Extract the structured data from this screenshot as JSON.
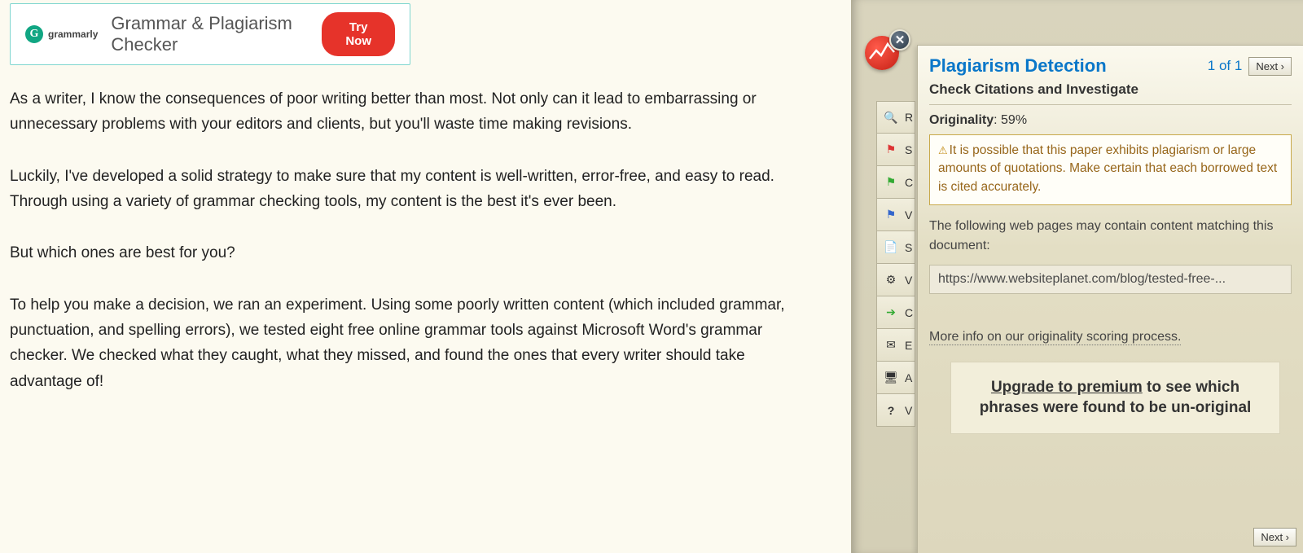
{
  "ad": {
    "logo_text": "grammarly",
    "logo_letter": "G",
    "title": "Grammar & Plagiarism Checker",
    "button": "Try Now"
  },
  "article": {
    "p1": "As a writer, I know the consequences of poor writing better than most. Not only can it lead to embarrassing or unnecessary problems with your editors and clients, but you'll waste time making revisions.",
    "p2": "Luckily, I've developed a solid strategy to make sure that my content is well-written, error-free, and easy to read. Through using a variety of grammar checking tools, my content is the best it's ever been.",
    "p3": "But which ones are best for you?",
    "p4": "To help you make a decision, we ran an experiment. Using some poorly written content (which included grammar, punctuation, and spelling errors), we tested eight free online grammar tools against Microsoft Word's grammar checker. We checked what they caught, what they missed, and found the ones that every writer should take advantage of!"
  },
  "rail": {
    "items": [
      "R",
      "S",
      "C",
      "V",
      "S",
      "V",
      "C",
      "E",
      "A",
      "V"
    ]
  },
  "popup": {
    "title": "Plagiarism Detection",
    "counter": "1 of 1",
    "next": "Next ›",
    "subtitle": "Check Citations and Investigate",
    "originality_label": "Originality",
    "originality_value": ": 59%",
    "warning": "It is possible that this paper exhibits plagiarism or large amounts of quotations. Make certain that each borrowed text is cited accurately.",
    "desc": "The following web pages may contain content matching this document:",
    "url": "https://www.websiteplanet.com/blog/tested-free-...",
    "more": "More info on our originality scoring process.",
    "upgrade_link": "Upgrade to premium",
    "upgrade_rest": " to see which phrases were found to be un-original"
  }
}
